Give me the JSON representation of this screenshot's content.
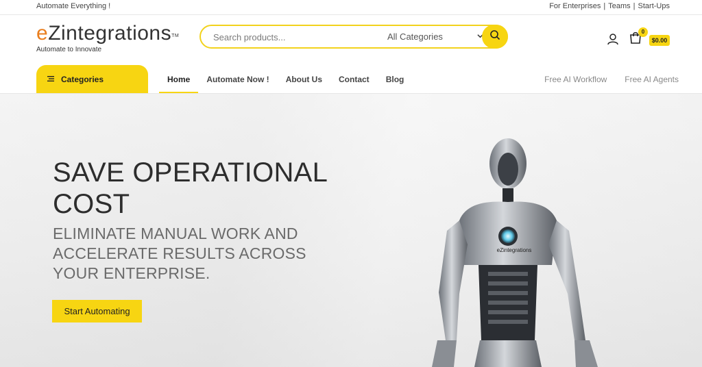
{
  "topbar": {
    "tagline": "Automate Everything !",
    "links": [
      "For Enterprises",
      "Teams",
      "Start-Ups"
    ],
    "separator": "|"
  },
  "header": {
    "logo_e": "e",
    "logo_z": "Z",
    "logo_rest": "integrations",
    "logo_tm": "TM",
    "logo_tagline": "Automate to Innovate",
    "search_placeholder": "Search products...",
    "category_select": "All Categories",
    "cart_count": "0",
    "cart_total": "$0.00"
  },
  "nav": {
    "categories_label": "Categories",
    "items": [
      "Home",
      "Automate Now !",
      "About Us",
      "Contact",
      "Blog"
    ],
    "right_items": [
      "Free AI Workflow",
      "Free AI Agents"
    ]
  },
  "hero": {
    "title": "SAVE OPERATIONAL COST",
    "subtitle": "ELIMINATE MANUAL WORK AND ACCELERATE RESULTS ACROSS YOUR ENTERPRISE.",
    "cta_label": "Start Automating",
    "robot_chest_label": "eZintegrations"
  },
  "colors": {
    "accent": "#f7d512",
    "logo_orange": "#e97e1e"
  },
  "icons": {
    "search": "search-icon",
    "user": "user-icon",
    "cart": "shopping-bag-icon",
    "categories": "menu-lines-icon",
    "chevron": "chevron-down-icon"
  }
}
